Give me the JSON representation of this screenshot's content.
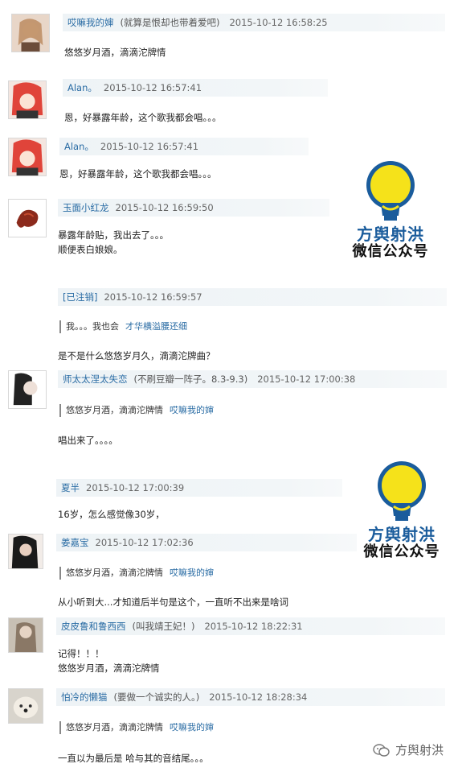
{
  "comments": [
    {
      "name": "哎嘛我的婶",
      "sig": "(就算是恨却也带着爱吧)",
      "time": "2015-10-12 16:58:25",
      "text": "悠悠岁月酒，滴滴沱牌情"
    },
    {
      "name": "Alan。",
      "time": "2015-10-12 16:57:41",
      "text": "恩，好暴露年龄，这个歌我都会唱。。。"
    },
    {
      "name": "Alan。",
      "time": "2015-10-12 16:57:41",
      "text": "恩，好暴露年龄，这个歌我都会唱。。。"
    },
    {
      "name": "玉面小红龙",
      "time": "2015-10-12 16:59:50",
      "text": "暴露年龄贴，我出去了。。。",
      "text2": "顺便表白娘娘。"
    },
    {
      "name": "[已注销]",
      "time": "2015-10-12 16:59:57",
      "quote": "我。。。我也会",
      "quote_author": "才华横溢腰还细",
      "text": "是不是什么悠悠岁月久，滴滴沱牌曲？"
    },
    {
      "name": "师太太涅太失恋",
      "sig": "(不刷豆瓣一阵子。8.3-9.3)",
      "time": "2015-10-12 17:00:38",
      "quote": "悠悠岁月酒，滴滴沱牌情",
      "quote_author": "哎嘛我的婶",
      "text": "唱出来了。。。。"
    },
    {
      "name": "夏半",
      "time": "2015-10-12 17:00:39",
      "text": "16岁，怎么感觉像30岁，"
    },
    {
      "name": "姜嘉宝",
      "time": "2015-10-12 17:02:36",
      "quote": "悠悠岁月酒，滴滴沱牌情",
      "quote_author": "哎嘛我的婶",
      "text": "从小听到大...才知道后半句是这个，一直听不出来是啥词"
    },
    {
      "name": "皮皮鲁和鲁西西",
      "sig": "(叫我靖王妃！)",
      "time": "2015-10-12 18:22:31",
      "text": "记得！！！",
      "text2": "悠悠岁月酒，滴滴沱牌情"
    },
    {
      "name": "怕冷的懒猫",
      "sig": "(要做一个诚实的人。)",
      "time": "2015-10-12 18:28:34",
      "quote": "悠悠岁月酒，滴滴沱牌情",
      "quote_author": "哎嘛我的婶",
      "text": "一直以为最后是 哈与其的音结尾。。。"
    }
  ],
  "logo": {
    "line1": "方舆射洪",
    "line2": "微信公众号"
  },
  "watermark": "方舆射洪",
  "colors": {
    "link": "#2a6ca4",
    "meta_bg": "#eef3f6",
    "bulb_yellow": "#f5e21a",
    "bulb_blue": "#1a5c9c"
  }
}
